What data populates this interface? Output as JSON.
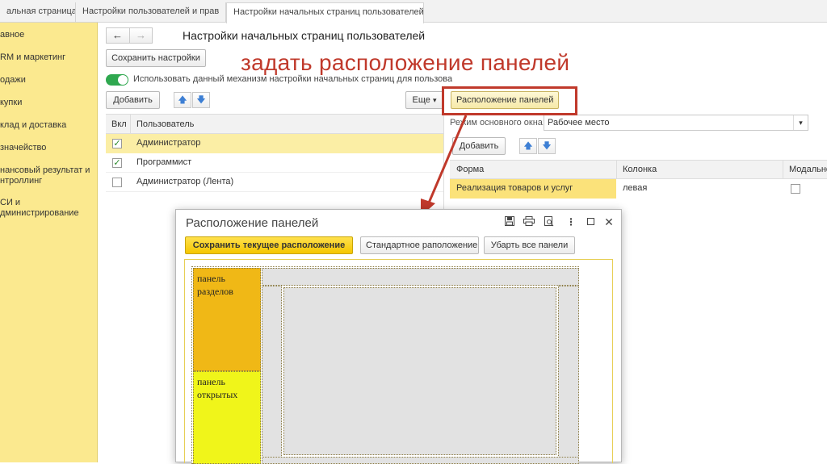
{
  "tabs": [
    {
      "label": "альная страница"
    },
    {
      "label": "Настройки пользователей и прав"
    },
    {
      "label": "Настройки начальных страниц пользователей",
      "close": "×"
    }
  ],
  "sidebar": {
    "items": [
      {
        "label": "авное"
      },
      {
        "label": "RM и маркетинг"
      },
      {
        "label": "одажи"
      },
      {
        "label": "купки"
      },
      {
        "label": "клад и доставка"
      },
      {
        "label": "значейство"
      },
      {
        "label": "нансовый результат и"
      },
      {
        "label": "нтроллинг"
      },
      {
        "label": "СИ и"
      },
      {
        "label": "дминистрирование"
      }
    ]
  },
  "nav": {
    "back": "←",
    "forward": "→"
  },
  "page_title": "Настройки начальных страниц пользователей",
  "save_settings": "Сохранить настройки",
  "toggle_label": "Использовать данный механизм настройки начальных страниц для пользователей",
  "left_toolbar": {
    "add": "Добавить",
    "up": "🡅",
    "down": "🡇",
    "more": "Еще"
  },
  "users_table": {
    "columns": [
      "Вкл",
      "Пользователь"
    ],
    "rows": [
      {
        "checked": true,
        "name": "Администратор"
      },
      {
        "checked": true,
        "name": "Программист"
      },
      {
        "checked": false,
        "name": "Администратор (Лента)"
      }
    ]
  },
  "right": {
    "layout_button": "Расположение панелей",
    "mode_label": "Режим основного окна:",
    "mode_value": "Рабочее место",
    "add": "Добавить",
    "columns": [
      "Форма",
      "Колонка",
      "Модально"
    ],
    "rows": [
      {
        "form": "Реализация товаров и услуг",
        "column": "левая"
      }
    ]
  },
  "annotation": "задать расположение панелей",
  "dialog": {
    "title": "Расположение панелей",
    "icons": [
      "save-icon",
      "print-icon",
      "preview-icon",
      "more-icon",
      "maximize-icon",
      "close-icon"
    ],
    "buttons": {
      "save_current": "Сохранить текущее расположение",
      "standard": "Стандартное раположение",
      "remove_all": "Убарть все панели"
    },
    "panels": {
      "sections": "панель разделов",
      "open": "панель открытых"
    },
    "colors": {
      "sections": "#f0b816",
      "open": "#f0f51a",
      "work_area": "#e2e2e2"
    }
  }
}
